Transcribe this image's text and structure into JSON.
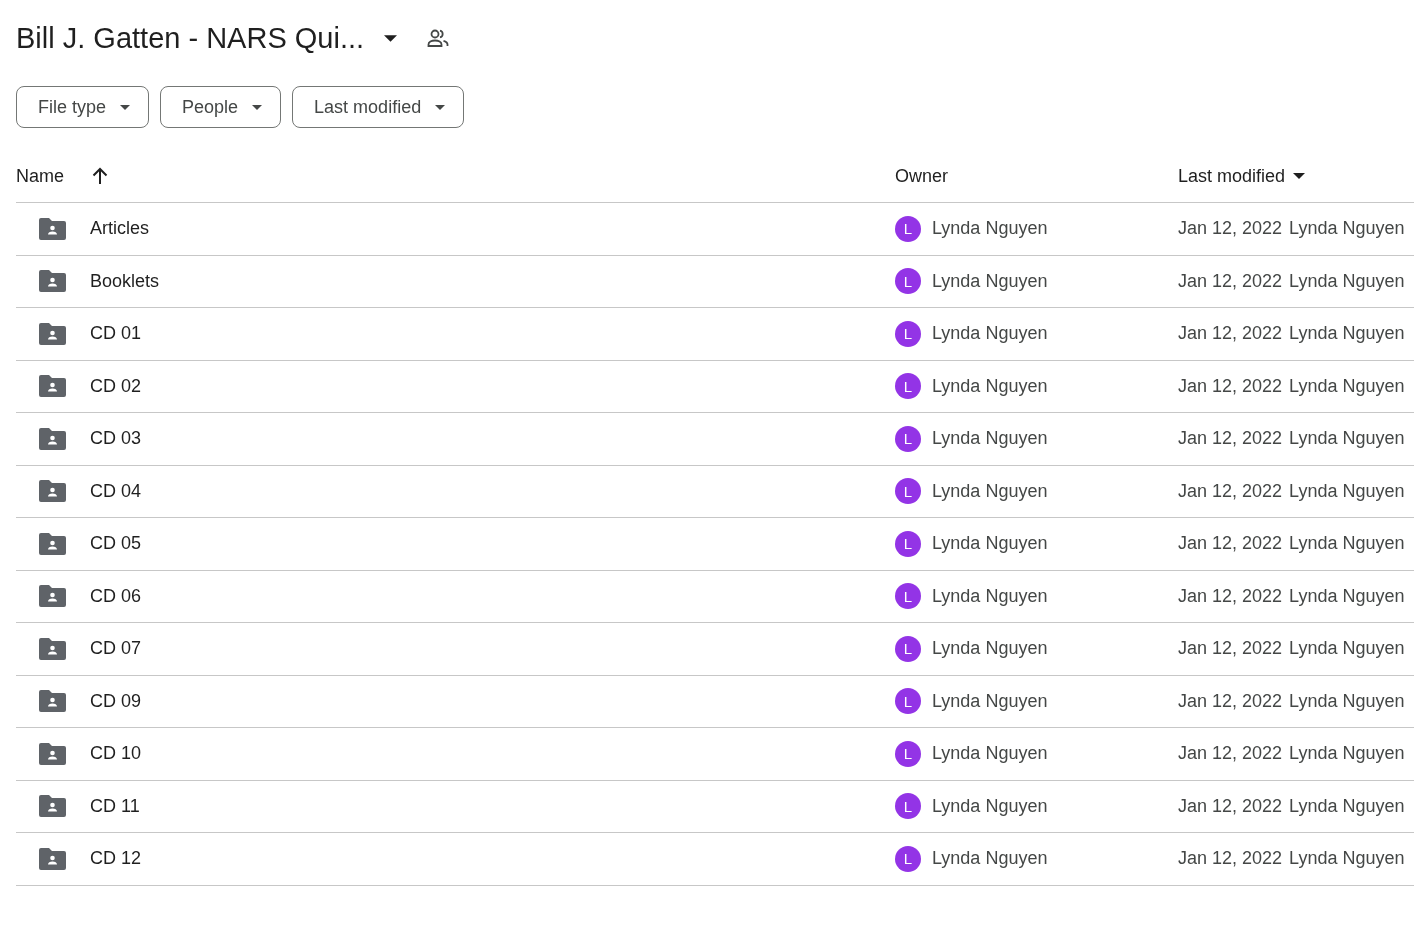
{
  "title": "Bill J. Gatten - NARS Qui...",
  "filters": [
    "File type",
    "People",
    "Last modified"
  ],
  "columns": {
    "name": "Name",
    "owner": "Owner",
    "modified": "Last modified"
  },
  "rows": [
    {
      "name": "Articles",
      "owner_initial": "L",
      "owner": "Lynda Nguyen",
      "date": "Jan 12, 2022",
      "modified_by": "Lynda Nguyen"
    },
    {
      "name": "Booklets",
      "owner_initial": "L",
      "owner": "Lynda Nguyen",
      "date": "Jan 12, 2022",
      "modified_by": "Lynda Nguyen"
    },
    {
      "name": "CD 01",
      "owner_initial": "L",
      "owner": "Lynda Nguyen",
      "date": "Jan 12, 2022",
      "modified_by": "Lynda Nguyen"
    },
    {
      "name": "CD 02",
      "owner_initial": "L",
      "owner": "Lynda Nguyen",
      "date": "Jan 12, 2022",
      "modified_by": "Lynda Nguyen"
    },
    {
      "name": "CD 03",
      "owner_initial": "L",
      "owner": "Lynda Nguyen",
      "date": "Jan 12, 2022",
      "modified_by": "Lynda Nguyen"
    },
    {
      "name": "CD 04",
      "owner_initial": "L",
      "owner": "Lynda Nguyen",
      "date": "Jan 12, 2022",
      "modified_by": "Lynda Nguyen"
    },
    {
      "name": "CD 05",
      "owner_initial": "L",
      "owner": "Lynda Nguyen",
      "date": "Jan 12, 2022",
      "modified_by": "Lynda Nguyen"
    },
    {
      "name": "CD 06",
      "owner_initial": "L",
      "owner": "Lynda Nguyen",
      "date": "Jan 12, 2022",
      "modified_by": "Lynda Nguyen"
    },
    {
      "name": "CD 07",
      "owner_initial": "L",
      "owner": "Lynda Nguyen",
      "date": "Jan 12, 2022",
      "modified_by": "Lynda Nguyen"
    },
    {
      "name": "CD 09",
      "owner_initial": "L",
      "owner": "Lynda Nguyen",
      "date": "Jan 12, 2022",
      "modified_by": "Lynda Nguyen"
    },
    {
      "name": "CD 10",
      "owner_initial": "L",
      "owner": "Lynda Nguyen",
      "date": "Jan 12, 2022",
      "modified_by": "Lynda Nguyen"
    },
    {
      "name": "CD 11",
      "owner_initial": "L",
      "owner": "Lynda Nguyen",
      "date": "Jan 12, 2022",
      "modified_by": "Lynda Nguyen"
    },
    {
      "name": "CD 12",
      "owner_initial": "L",
      "owner": "Lynda Nguyen",
      "date": "Jan 12, 2022",
      "modified_by": "Lynda Nguyen"
    }
  ]
}
